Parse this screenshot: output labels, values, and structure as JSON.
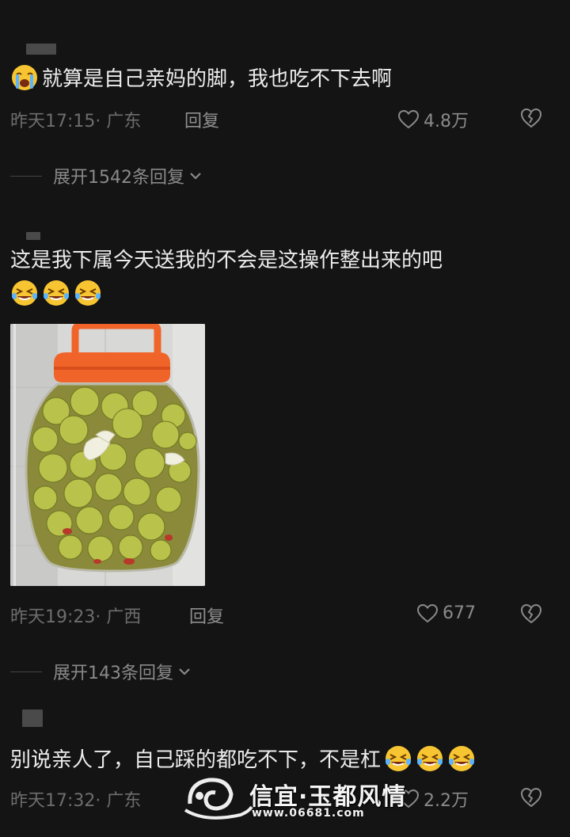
{
  "comments": [
    {
      "text": "就算是自己亲妈的脚，我也吃不下去啊",
      "time": "昨天17:15· 广东",
      "reply": "回复",
      "likes": "4.8万",
      "expand": "展开1542条回复"
    },
    {
      "text": "这是我下属今天送我的不会是这操作整出来的吧",
      "time": "昨天19:23· 广西",
      "reply": "回复",
      "likes": "677",
      "expand": "展开143条回复"
    },
    {
      "text": "别说亲人了，自己踩的都吃不下，不是杠",
      "time": "昨天17:32· 广东",
      "likes": "2.2万"
    }
  ],
  "icons": {
    "crying_emoji": "crying-face-emoji",
    "laughing_emoji": "rolling-laughing-emoji",
    "like": "heart-outline-icon",
    "dislike": "broken-heart-icon",
    "expand": "chevron-down-icon"
  },
  "watermark": {
    "title": "信宜·玉都风情",
    "url": "www.06681.com"
  },
  "colors": {
    "background": "#141414",
    "text": "#ececec",
    "meta": "#6d6d6d",
    "jar_lid": "#f0642a"
  }
}
